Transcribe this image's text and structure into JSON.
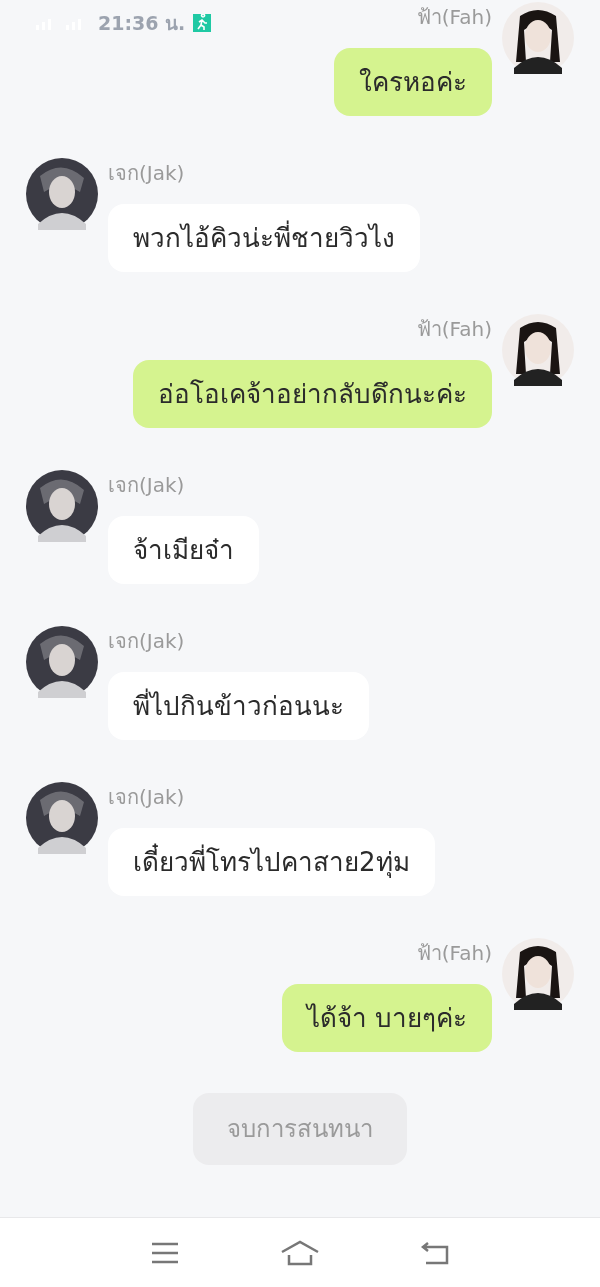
{
  "status_bar": {
    "time": "21:36 น."
  },
  "messages": [
    {
      "kind": "sent",
      "sender": "ฟ้า(Fah)",
      "text": "ใครหอค่ะ"
    },
    {
      "kind": "received",
      "sender": "เจก(Jak)",
      "text": "พวกไอ้คิวน่ะพี่ชายวิวไง"
    },
    {
      "kind": "sent",
      "sender": "ฟ้า(Fah)",
      "text": "อ่อโอเคจ้าอย่ากลับดึกนะค่ะ"
    },
    {
      "kind": "received",
      "sender": "เจก(Jak)",
      "text": "จ้าเมียจ๋า"
    },
    {
      "kind": "received",
      "sender": "เจก(Jak)",
      "text": "พี่ไปกินข้าวก่อนนะ"
    },
    {
      "kind": "received",
      "sender": "เจก(Jak)",
      "text": "เดี๋ยวพี่โทรไปคาสาย2ทุ่ม"
    },
    {
      "kind": "sent",
      "sender": "ฟ้า(Fah)",
      "text": "ได้จ้า บายๆค่ะ"
    }
  ],
  "end_chat_button": "จบการสนทนา"
}
